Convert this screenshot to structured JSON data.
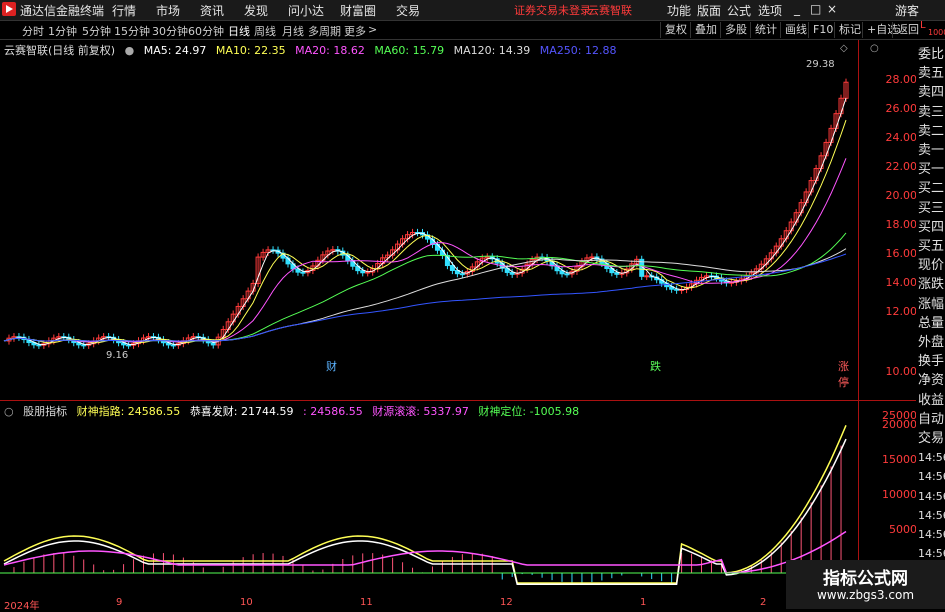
{
  "app": {
    "title": "通达信金融终端",
    "menu": [
      "行情",
      "市场",
      "资讯",
      "发现",
      "问小达",
      "财富圈",
      "交易"
    ],
    "alert": "证券交易未登录",
    "alert_stock": "云赛智联",
    "right_menu": [
      "功能",
      "版面",
      "公式",
      "选项"
    ],
    "guest": "游客",
    "window_controls": [
      "_",
      "□",
      "×"
    ]
  },
  "toolbar": {
    "periods": [
      "分时",
      "1分钟",
      "5分钟",
      "15分钟",
      "30分钟",
      "60分钟",
      "日线",
      "周线",
      "月线",
      "多周期",
      "更多"
    ],
    "active_period": "日线",
    "more_arrow": ">",
    "right_buttons": [
      "复权",
      "叠加",
      "多股",
      "统计",
      "画线",
      "F10",
      "标记",
      "+自选",
      "返回"
    ]
  },
  "main": {
    "title": "云赛智联(日线 前复权)",
    "ma": [
      {
        "label": "MA5: 24.97",
        "color": "#ffffff"
      },
      {
        "label": "MA10: 22.35",
        "color": "#ffff55"
      },
      {
        "label": "MA20: 18.62",
        "color": "#ff55ff"
      },
      {
        "label": "MA60: 15.79",
        "color": "#55ff55"
      },
      {
        "label": "MA120: 14.39",
        "color": "#dddddd"
      },
      {
        "label": "MA250: 12.88",
        "color": "#5555ff"
      }
    ],
    "axis": [
      "28.00",
      "26.00",
      "24.00",
      "22.00",
      "20.00",
      "18.00",
      "16.00",
      "14.00",
      "12.00",
      "10.00"
    ],
    "high_label": "29.38",
    "low_label": "9.16",
    "markers": [
      "财",
      "跌",
      "涨停"
    ]
  },
  "sub": {
    "name": "股朋指标",
    "values": [
      {
        "label": "财神指路: 24586.55",
        "color": "#ffff55"
      },
      {
        "label": "恭喜发财: 21744.59",
        "color": "#ffffff"
      },
      {
        "label": ": 24586.55",
        "color": "#ff55ff"
      },
      {
        "label": "财源滚滚: 5337.97",
        "color": "#ff55ff"
      },
      {
        "label": "财神定位: -1005.98",
        "color": "#55ff55"
      }
    ],
    "axis": [
      "25000",
      "20000",
      "15000",
      "10000",
      "5000"
    ]
  },
  "side": {
    "top_label": "L",
    "top_sub": "1000",
    "items": [
      "委比",
      "卖五",
      "卖四",
      "卖三",
      "卖二",
      "卖一",
      "买一",
      "买二",
      "买三",
      "买四",
      "买五",
      "现价",
      "涨跌",
      "涨幅",
      "总量",
      "外盘",
      "换手",
      "净资",
      "收益",
      "自动",
      "交易",
      "14:56",
      "14:56",
      "14:56",
      "14:56",
      "14:56",
      "14:56",
      "14:56",
      "14:56"
    ]
  },
  "dates": [
    "2024年",
    "9",
    "10",
    "11",
    "12",
    "1",
    "2"
  ],
  "watermark": {
    "title": "指标公式网",
    "url": "www.zbgs3.com"
  }
}
